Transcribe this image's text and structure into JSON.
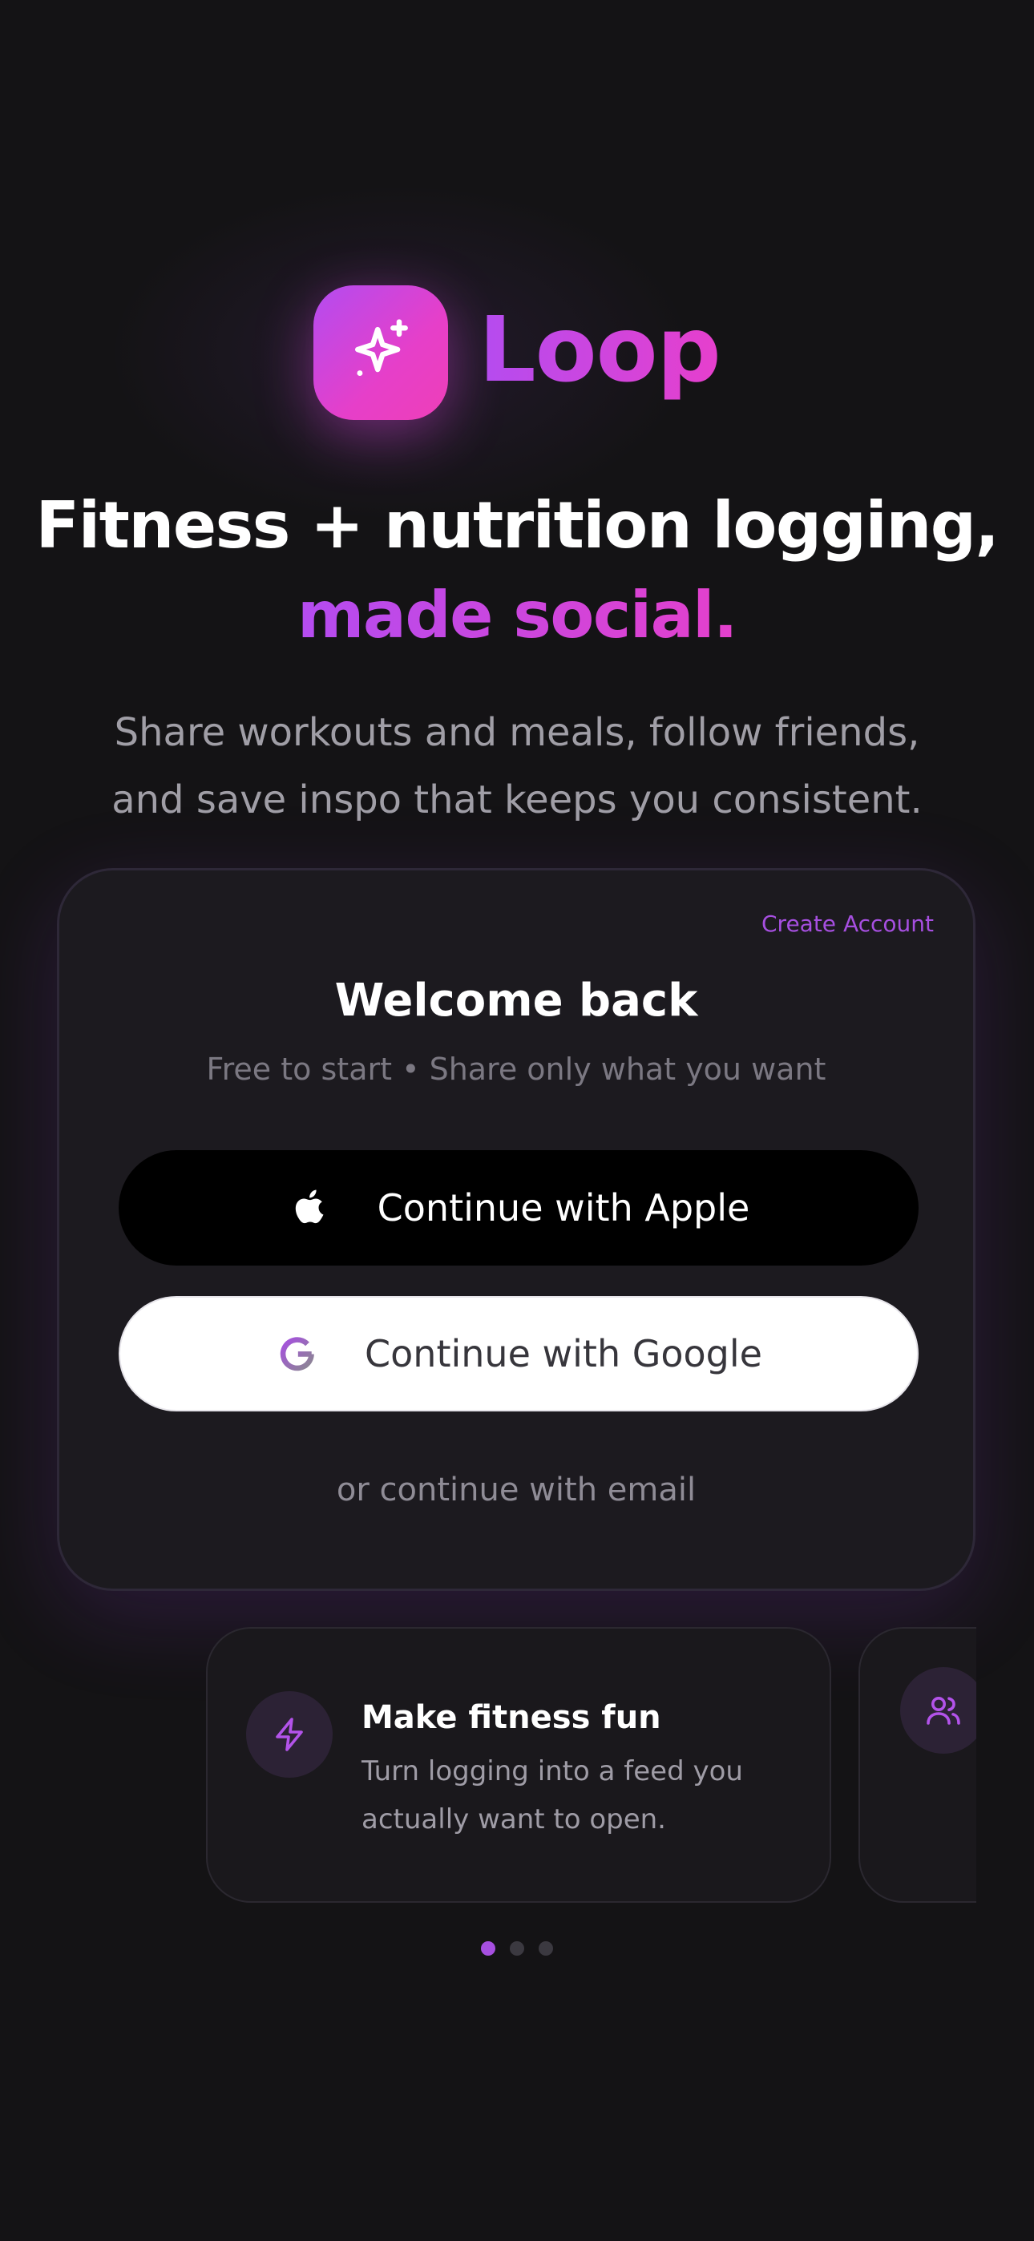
{
  "brand": {
    "name": "Loop",
    "icon": "sparkles-icon"
  },
  "hero": {
    "headline_line1": "Fitness + nutrition logging,",
    "headline_line2": "made social.",
    "subtitle": "Share workouts and meals, follow friends, and save inspo that keeps you consistent."
  },
  "auth_card": {
    "create_account": "Create Account",
    "title": "Welcome back",
    "subtitle": "Free to start • Share only what you want",
    "apple_button": {
      "label": "Continue with Apple",
      "icon": "apple-icon"
    },
    "google_button": {
      "label": "Continue with Google",
      "icon": "google-icon"
    },
    "email_link": "or continue with email"
  },
  "features": [
    {
      "icon": "lightning-icon",
      "title": "Make fitness fun",
      "description": "Turn logging into a feed you actually want to open."
    },
    {
      "icon": "users-icon",
      "title": "",
      "description": ""
    }
  ],
  "carousel": {
    "total_pages": 3,
    "active_page": 1
  },
  "colors": {
    "background": "#141315",
    "accent_purple": "#a64fe0",
    "accent_pink": "#e73fcc",
    "card_background": "#1c1a1f"
  }
}
